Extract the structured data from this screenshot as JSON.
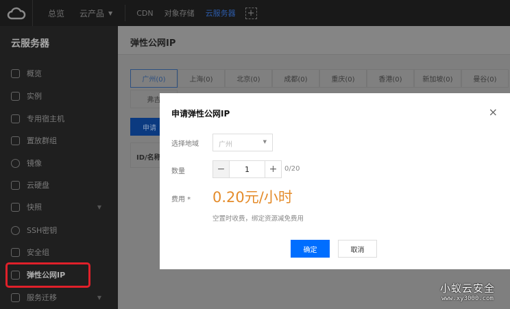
{
  "topbar": {
    "items": [
      {
        "label": "总览"
      },
      {
        "label": "云产品"
      },
      {
        "label": "CDN"
      },
      {
        "label": "对象存储"
      },
      {
        "label": "云服务器"
      }
    ],
    "add_label": "+"
  },
  "sidebar": {
    "title": "云服务器",
    "items": [
      {
        "label": "概览"
      },
      {
        "label": "实例"
      },
      {
        "label": "专用宿主机"
      },
      {
        "label": "置放群组"
      },
      {
        "label": "镜像"
      },
      {
        "label": "云硬盘"
      },
      {
        "label": "快照"
      },
      {
        "label": "SSH密钥"
      },
      {
        "label": "安全组"
      },
      {
        "label": "弹性公网IP"
      },
      {
        "label": "服务迁移"
      }
    ]
  },
  "main": {
    "title": "弹性公网IP",
    "regions": [
      {
        "label": "广州(0)"
      },
      {
        "label": "上海(0)"
      },
      {
        "label": "北京(0)"
      },
      {
        "label": "成都(0)"
      },
      {
        "label": "重庆(0)"
      },
      {
        "label": "香港(0)"
      },
      {
        "label": "新加坡(0)"
      },
      {
        "label": "曼谷(0)"
      }
    ],
    "region_row2": "弗吉",
    "apply_label": "申请",
    "table_header": "ID/名称"
  },
  "modal": {
    "title": "申请弹性公网IP",
    "close": "×",
    "region_label": "选择地域",
    "region_value": "广州",
    "qty_label": "数量",
    "qty_value": "1",
    "qty_minus": "−",
    "qty_plus": "+",
    "qty_limit": "0/20",
    "fee_label": "费用 *",
    "price": "0.20元/小时",
    "note": "空置时收费，绑定资源减免费用",
    "ok_label": "确定",
    "cancel_label": "取消"
  },
  "watermark": {
    "line1": "小蚁云安全",
    "line2": "www.xy3000.com"
  },
  "colors": {
    "primary": "#006eff",
    "price": "#e48b2a",
    "highlight": "#e0202a"
  }
}
